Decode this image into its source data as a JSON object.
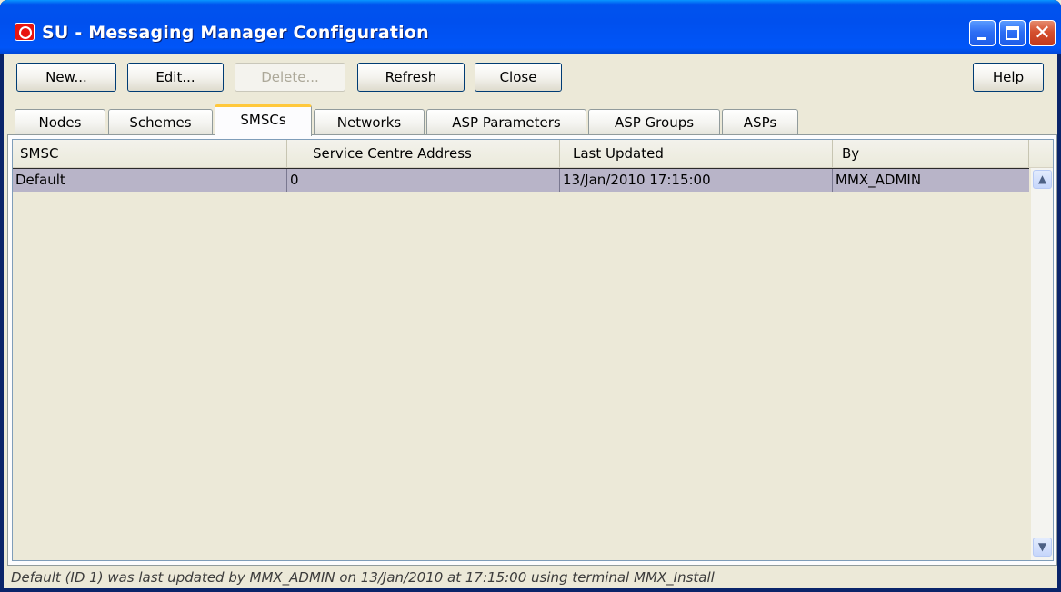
{
  "window": {
    "title": "SU - Messaging Manager Configuration",
    "app_icon": "oracle-icon"
  },
  "toolbar": {
    "new_label": "New...",
    "edit_label": "Edit...",
    "delete_label": "Delete...",
    "refresh_label": "Refresh",
    "close_label": "Close",
    "help_label": "Help"
  },
  "tabs": [
    {
      "label": "Nodes"
    },
    {
      "label": "Schemes"
    },
    {
      "label": "SMSCs"
    },
    {
      "label": "Networks"
    },
    {
      "label": "ASP Parameters"
    },
    {
      "label": "ASP Groups"
    },
    {
      "label": "ASPs"
    }
  ],
  "active_tab": "SMSCs",
  "table": {
    "columns": [
      "SMSC",
      "Service Centre Address",
      "Last Updated",
      "By"
    ],
    "rows": [
      [
        "Default",
        "0",
        "13/Jan/2010 17:15:00",
        "MMX_ADMIN"
      ]
    ]
  },
  "status": {
    "text": "Default (ID 1) was last updated by MMX_ADMIN on 13/Jan/2010 at 17:15:00 using terminal MMX_Install"
  },
  "colors": {
    "titlebar": "#0053ee",
    "selected_row": "#b8b4c8",
    "active_tab_accent": "#ffc83c"
  }
}
